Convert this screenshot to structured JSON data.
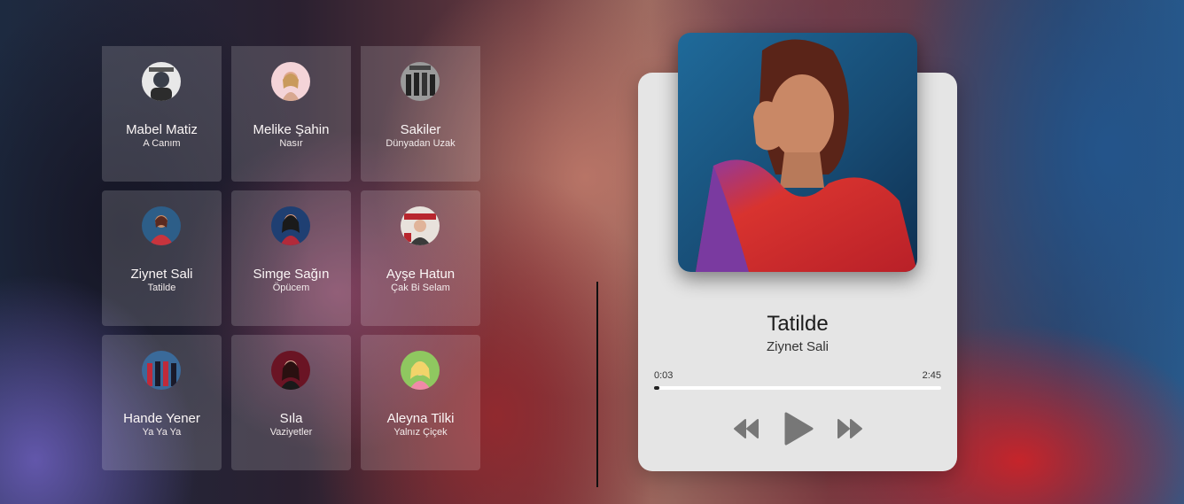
{
  "playlist": [
    {
      "artist": "Mabel Matiz",
      "song": "A Canım",
      "avatar_color": "#3a3f4a"
    },
    {
      "artist": "Melike Şahin",
      "song": "Nasır",
      "avatar_color": "#e9b9c0"
    },
    {
      "artist": "Sakiler",
      "song": "Dünyadan Uzak",
      "avatar_color": "#6b6b6b"
    },
    {
      "artist": "Ziynet Sali",
      "song": "Tatilde",
      "avatar_color": "#c8343d"
    },
    {
      "artist": "Simge Sağın",
      "song": "Öpücem",
      "avatar_color": "#b22a3a"
    },
    {
      "artist": "Ayşe Hatun",
      "song": "Çak Bi Selam",
      "avatar_color": "#d8d2cc"
    },
    {
      "artist": "Hande Yener",
      "song": "Ya Ya Ya",
      "avatar_color": "#2f4f78"
    },
    {
      "artist": "Sıla",
      "song": "Vaziyetler",
      "avatar_color": "#8a1a2c"
    },
    {
      "artist": "Aleyna Tilki",
      "song": "Yalnız Çiçek",
      "avatar_color": "#8fc760"
    }
  ],
  "player": {
    "title": "Tatilde",
    "artist": "Ziynet Sali",
    "current_time": "0:03",
    "duration": "2:45",
    "progress": 0.018,
    "icons": {
      "prev": "rewind-icon",
      "play": "play-icon",
      "next": "fast-forward-icon"
    }
  },
  "colors": {
    "player_bg": "#e5e5e5",
    "control": "#777777"
  }
}
